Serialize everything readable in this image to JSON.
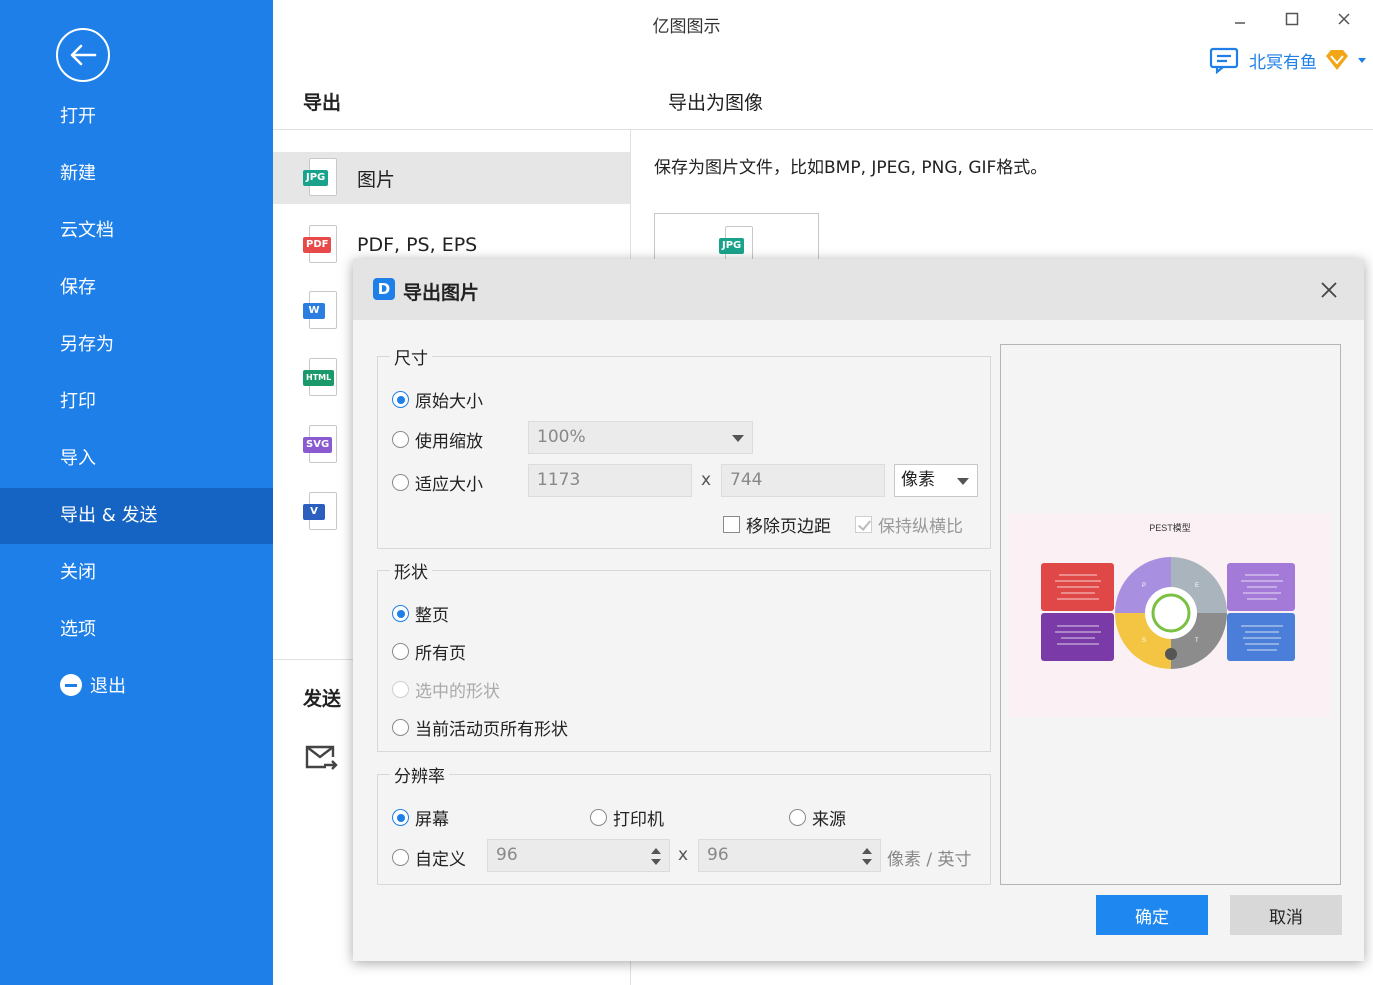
{
  "app": {
    "title": "亿图图示"
  },
  "sidebar": {
    "items": [
      {
        "label": "打开"
      },
      {
        "label": "新建"
      },
      {
        "label": "云文档"
      },
      {
        "label": "保存"
      },
      {
        "label": "另存为"
      },
      {
        "label": "打印"
      },
      {
        "label": "导入"
      },
      {
        "label": "导出 & 发送"
      },
      {
        "label": "关闭"
      },
      {
        "label": "选项"
      },
      {
        "label": "退出"
      }
    ],
    "active_index": 7
  },
  "user": {
    "name": "北冥有鱼"
  },
  "export": {
    "heading": "导出",
    "right_heading": "导出为图像",
    "description": "保存为图片文件，比如BMP, JPEG, PNG, GIF格式。",
    "formats": [
      {
        "tag": "JPG",
        "label": "图片",
        "color": "#1aa38c"
      },
      {
        "tag": "PDF",
        "label": "PDF, PS, EPS",
        "color": "#e84a4a"
      },
      {
        "tag": "W",
        "label": "",
        "color": "#2b7de0"
      },
      {
        "tag": "HTML",
        "label": "",
        "color": "#1a9a6a"
      },
      {
        "tag": "SVG",
        "label": "",
        "color": "#8a5ad0"
      },
      {
        "tag": "V",
        "label": "",
        "color": "#2b5fbf"
      }
    ],
    "preview_tag": "JPG",
    "send_heading": "发送"
  },
  "dialog": {
    "title": "导出图片",
    "size": {
      "legend": "尺寸",
      "original": "原始大小",
      "scale": "使用缩放",
      "scale_value": "100%",
      "fit": "适应大小",
      "width": "1173",
      "height": "744",
      "x": "x",
      "unit": "像素",
      "remove_margin": "移除页边距",
      "keep_ratio": "保持纵横比"
    },
    "shape": {
      "legend": "形状",
      "whole_page": "整页",
      "all_pages": "所有页",
      "selected_shapes": "选中的形状",
      "active_page_shapes": "当前活动页所有形状"
    },
    "resolution": {
      "legend": "分辨率",
      "screen": "屏幕",
      "printer": "打印机",
      "source": "来源",
      "custom": "自定义",
      "dpi_x": "96",
      "dpi_y": "96",
      "x": "x",
      "unit": "像素 / 英寸"
    },
    "ok": "确定",
    "cancel": "取消"
  },
  "preview_diagram": {
    "title": "PEST模型",
    "segment_letters": [
      "P",
      "E",
      "S",
      "T"
    ],
    "colors": {
      "red": "#e04848",
      "purple": "#7a3aa8",
      "lavender": "#a47ad8",
      "blue": "#4a7ed8",
      "ring_purple": "#a98fe0",
      "ring_grey": "#a9b4bc",
      "ring_yellow": "#f4c542",
      "ring_dark": "#8c8c8c"
    }
  }
}
